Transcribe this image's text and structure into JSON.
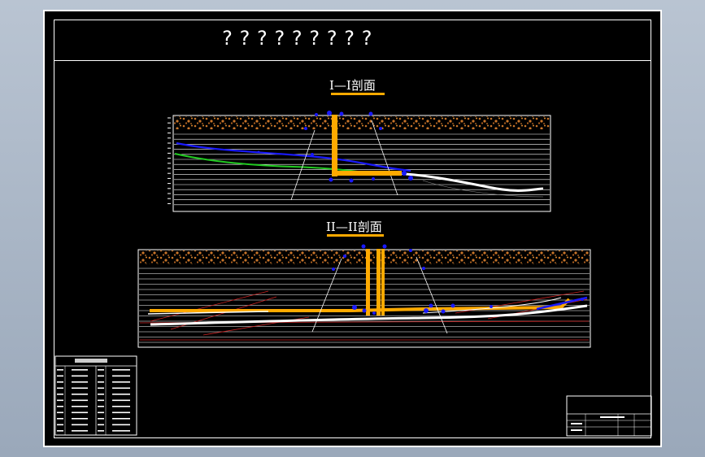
{
  "drawing": {
    "title": "?????????",
    "section1": {
      "label": "I—I剖面"
    },
    "section2": {
      "label": "II—II剖面"
    }
  },
  "colors": {
    "background": "#000000",
    "frame": "#ffffff",
    "soil": "#c8752a",
    "highlight": "#ffaa00",
    "blue_line": "#1a1aff",
    "green_line": "#22cc22",
    "red_line": "#cc2222"
  }
}
